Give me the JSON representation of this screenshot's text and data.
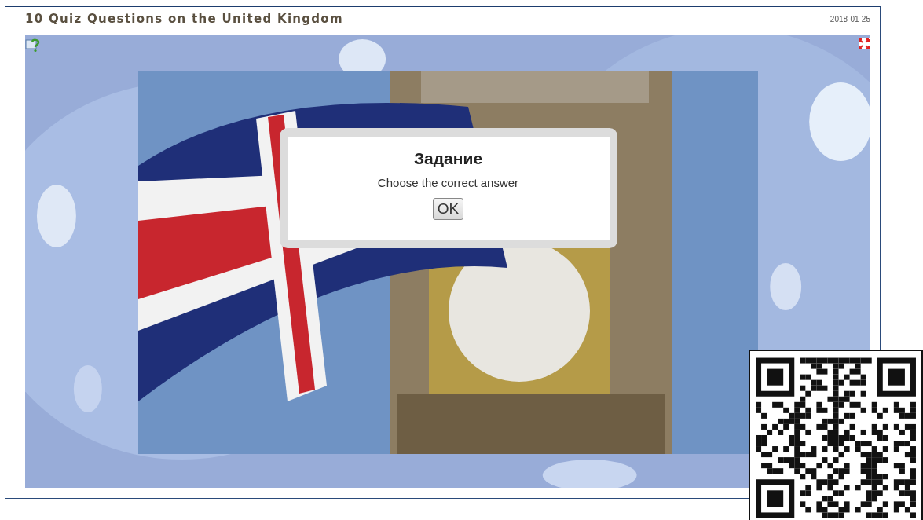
{
  "page": {
    "title": "10 Quiz Questions on the United Kingdom",
    "date": "2018-01-25"
  },
  "dialog": {
    "title": "Задание",
    "message": "Choose the correct answer",
    "button": "OK"
  }
}
